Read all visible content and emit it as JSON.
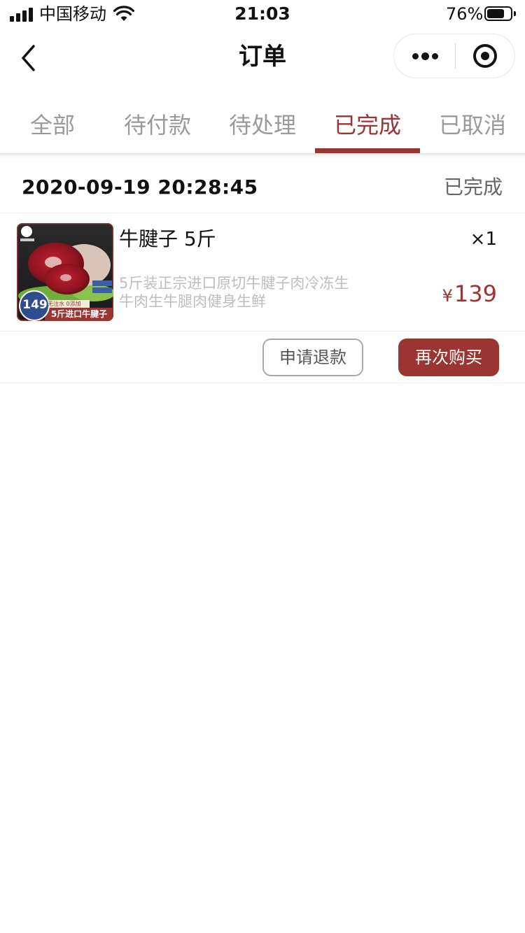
{
  "status_bar": {
    "carrier": "中国移动",
    "time": "21:03",
    "battery_percent_text": "76%",
    "battery_level": 0.76
  },
  "nav": {
    "title": "订单",
    "back_icon": "chevron-left-icon",
    "more_icon": "more-dots-icon",
    "close_icon": "target-close-icon"
  },
  "tabs": [
    {
      "label": "全部",
      "active": false
    },
    {
      "label": "待付款",
      "active": false
    },
    {
      "label": "待处理",
      "active": false
    },
    {
      "label": "已完成",
      "active": true
    },
    {
      "label": "已取消",
      "active": false
    }
  ],
  "order": {
    "datetime": "2020-09-19 20:28:45",
    "status": "已完成",
    "product": {
      "name": "牛腱子 5斤",
      "quantity": "×1",
      "description": "5斤装正宗进口原切牛腱子肉冷冻生牛肉生牛腿肉健身生鲜",
      "currency": "¥",
      "price": "139",
      "thumb": {
        "badge_price": "149",
        "bottom_text": "5斤进口牛腱子",
        "tag_text": "无注水 0添加"
      }
    },
    "actions": {
      "refund_label": "申请退款",
      "rebuy_label": "再次购买"
    }
  },
  "colors": {
    "accent": "#9b3532",
    "tab_inactive": "#9a9a9a",
    "desc_gray": "#bdbdbd"
  }
}
